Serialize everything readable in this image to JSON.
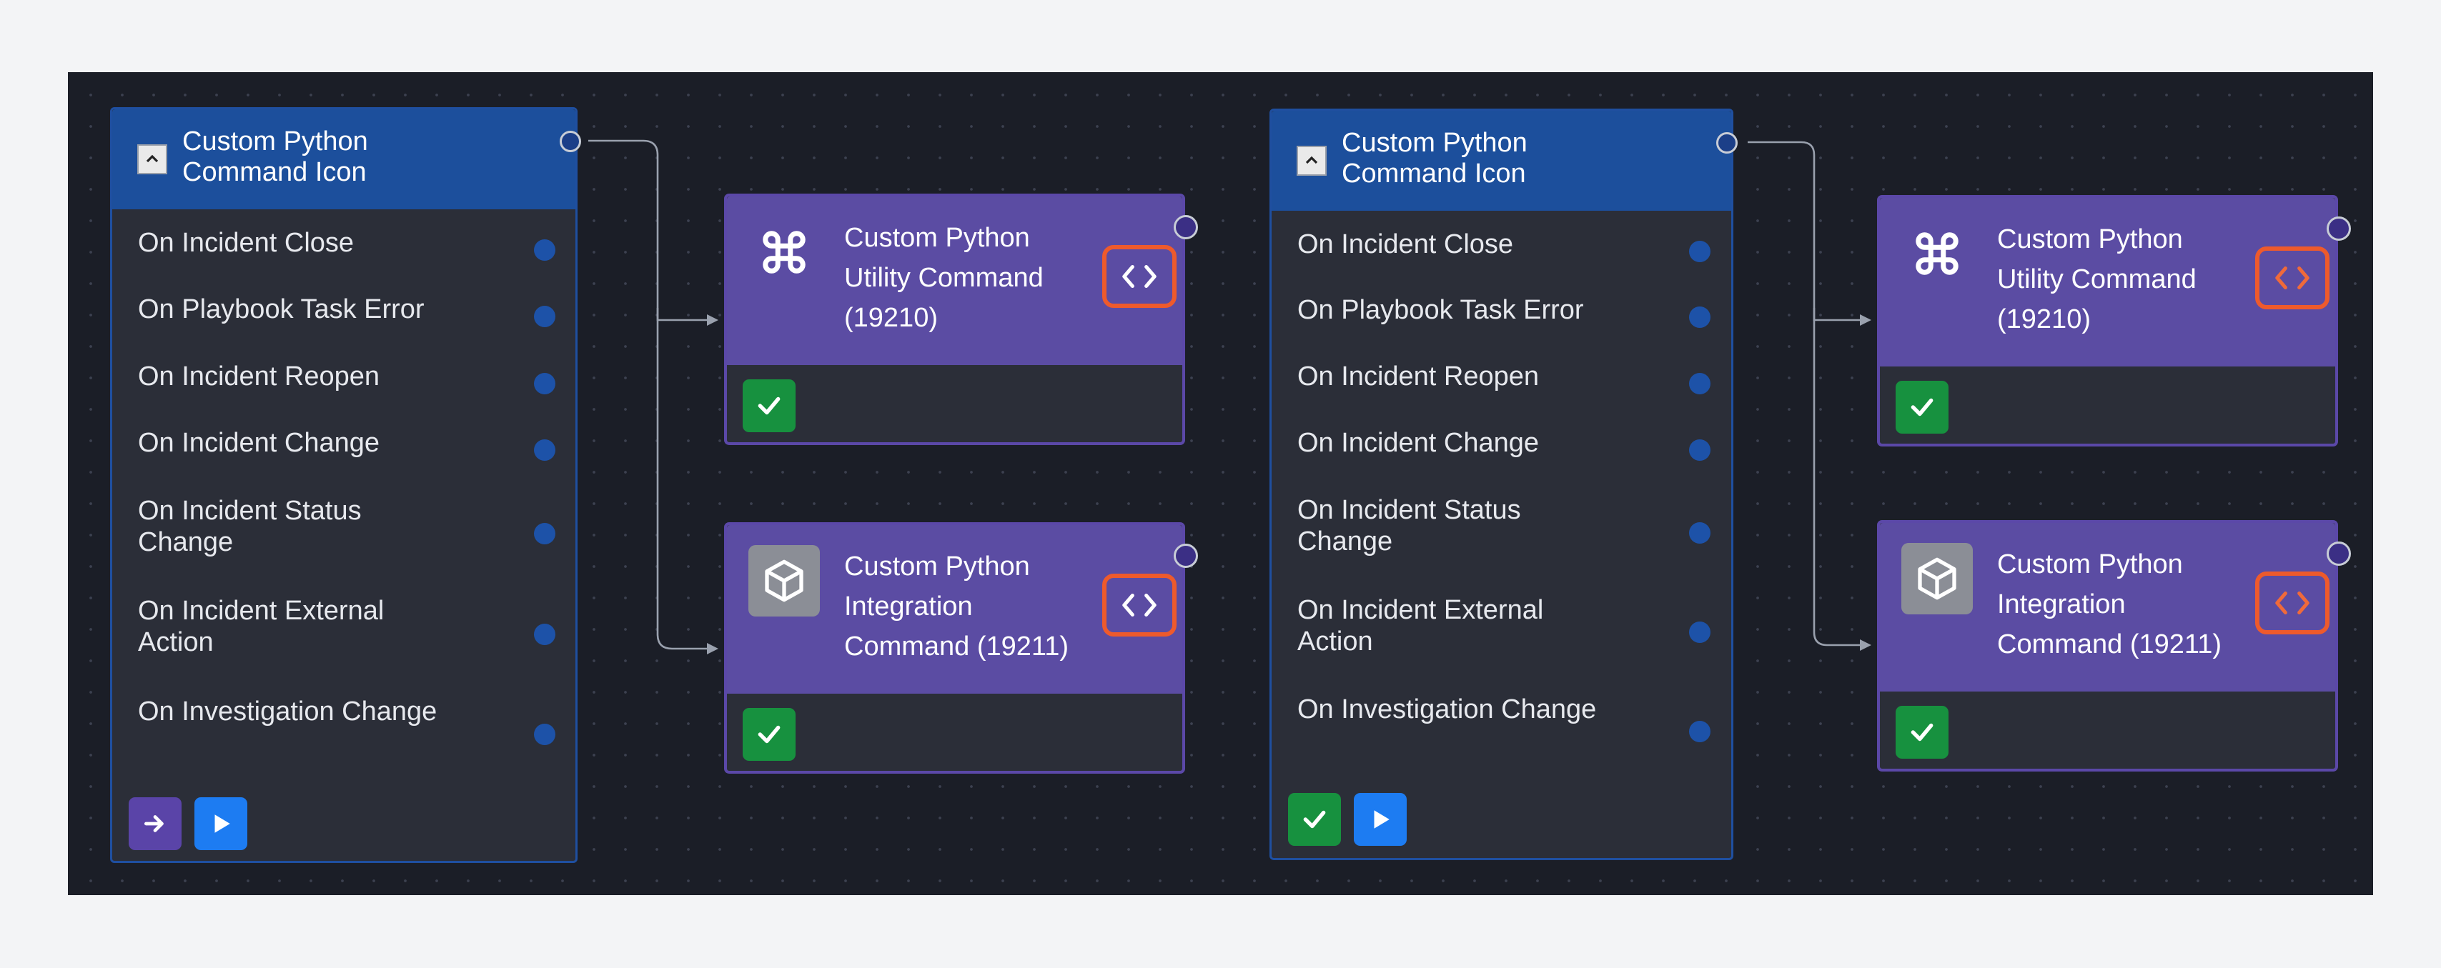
{
  "trigger_nodes": [
    {
      "title": "Custom Python Command Icon",
      "events": [
        "On Incident Close",
        "On Playbook Task Error",
        "On Incident Reopen",
        "On Incident Change",
        "On Incident Status Change",
        "On Incident External Action",
        "On Investigation Change"
      ],
      "footer_buttons": [
        "arrow-right-icon",
        "play-icon"
      ]
    },
    {
      "title": "Custom Python Command Icon",
      "events": [
        "On Incident Close",
        "On Playbook Task Error",
        "On Incident Reopen",
        "On Incident Change",
        "On Incident Status Change",
        "On Incident External Action",
        "On Investigation Change"
      ],
      "footer_buttons": [
        "check-icon",
        "play-icon"
      ]
    }
  ],
  "command_nodes": [
    {
      "title": "Custom Python Utility Command (19210)",
      "icon": "command-key-icon"
    },
    {
      "title": "Custom Python Integration Command (19211)",
      "icon": "cube-icon"
    },
    {
      "title": "Custom Python Utility Command (19210)",
      "icon": "command-key-icon"
    },
    {
      "title": "Custom Python Integration Command (19211)",
      "icon": "cube-icon"
    }
  ],
  "colors": {
    "canvas_bg": "#1b1e27",
    "trigger_header": "#1c4f9c",
    "command_header": "#5b4ca3",
    "code_button_border": "#ee5a2c",
    "success_green": "#17913f",
    "play_blue": "#1d7cf2"
  }
}
